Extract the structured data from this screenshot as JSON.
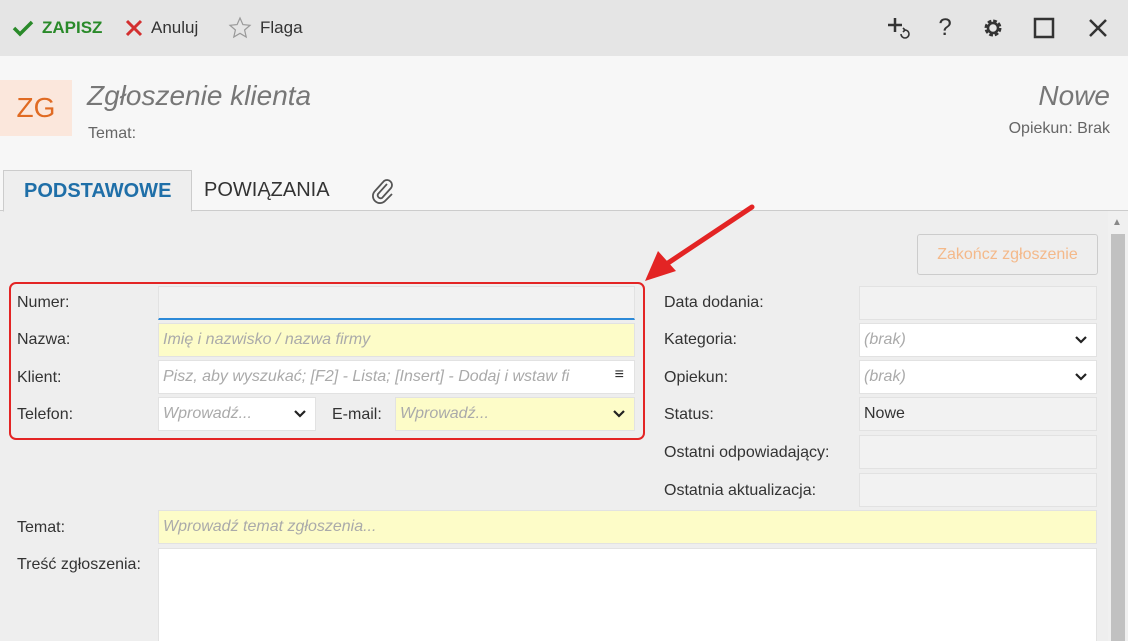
{
  "toolbar": {
    "save_label": "ZAPISZ",
    "cancel_label": "Anuluj",
    "flag_label": "Flaga",
    "icons": [
      "add-reload-icon",
      "help-icon",
      "gear-icon",
      "maximize-icon",
      "close-icon"
    ],
    "help_glyph": "?",
    "save_color": "#2a8a2a",
    "cancel_color": "#d32f2f"
  },
  "header": {
    "badge": "ZG",
    "title": "Zgłoszenie klienta",
    "subject_label": "Temat:",
    "status": "Nowe",
    "owner": "Opiekun: Brak"
  },
  "tabs": [
    {
      "label": "PODSTAWOWE",
      "active": true
    },
    {
      "label": "POWIĄZANIA",
      "active": false
    }
  ],
  "form": {
    "finish_button": "Zakończ zgłoszenie",
    "numer_label": "Numer:",
    "numer_value": "",
    "nazwa_label": "Nazwa:",
    "nazwa_placeholder": "Imię i nazwisko / nazwa firmy",
    "klient_label": "Klient:",
    "klient_placeholder": "Pisz, aby wyszukać; [F2] - Lista; [Insert] - Dodaj i wstaw fi",
    "telefon_label": "Telefon:",
    "telefon_placeholder": "Wprowadź...",
    "email_label": "E-mail:",
    "email_placeholder": "Wprowadź...",
    "data_dodania_label": "Data dodania:",
    "kategoria_label": "Kategoria:",
    "kategoria_value": "(brak)",
    "opiekun_label": "Opiekun:",
    "opiekun_value": "(brak)",
    "status_label": "Status:",
    "status_value": "Nowe",
    "ostatni_odp_label": "Ostatni odpowiadający:",
    "ostatnia_akt_label": "Ostatnia aktualizacja:",
    "temat_label": "Temat:",
    "temat_placeholder": "Wprowadź temat zgłoszenia...",
    "tresc_label": "Treść zgłoszenia:"
  },
  "colors": {
    "accent_blue": "#1f6fa8",
    "highlight_red": "#e32424",
    "required_yellow": "#fdfcc8",
    "badge_orange": "#e06b23"
  }
}
